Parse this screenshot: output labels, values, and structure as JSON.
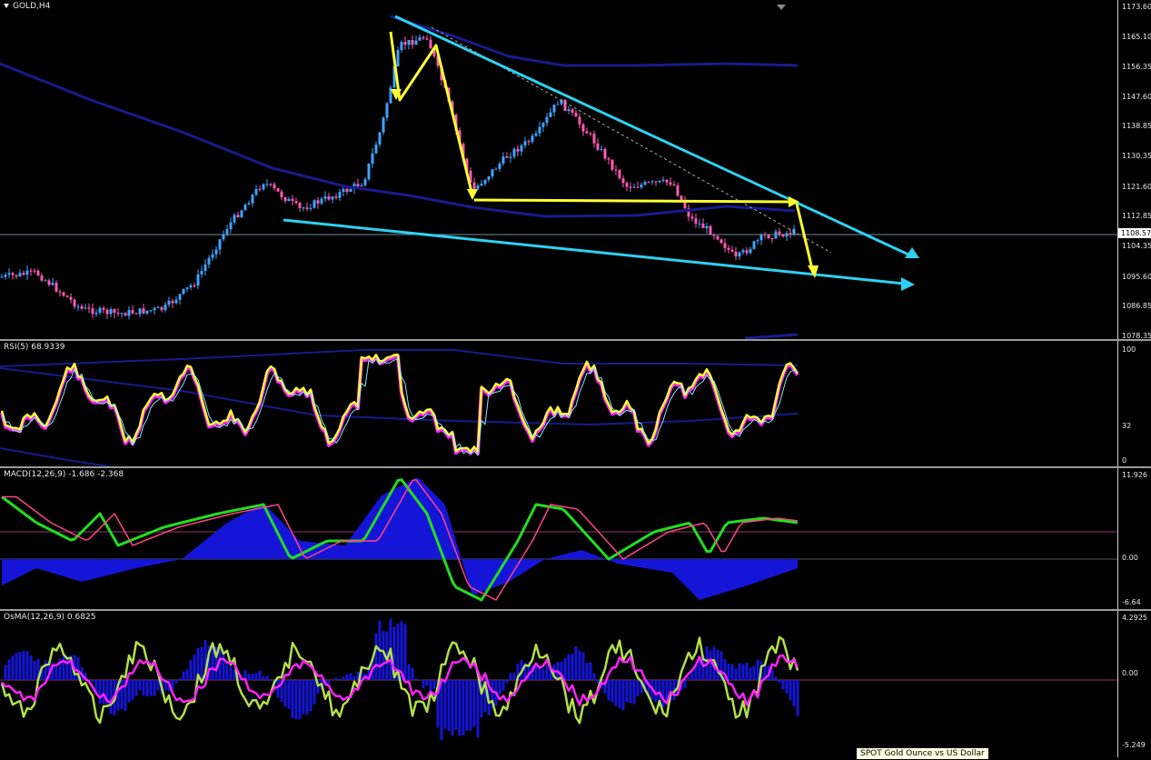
{
  "main": {
    "title": "GOLD,H4",
    "price_ticks": [
      "1173.60",
      "1165.10",
      "1156.35",
      "1147.60",
      "1138.85",
      "1130.35",
      "1121.60",
      "1112.85",
      "1104.35",
      "1095.60",
      "1086.85",
      "1078.35"
    ],
    "current_price": "1108.57"
  },
  "rsi": {
    "title": "RSI(5) 68.9339",
    "ticks": [
      "100",
      "32",
      "0"
    ]
  },
  "macd": {
    "title": "MACD(12,26,9) -1.686 -2.368",
    "ticks": [
      "11.926",
      "0.00",
      "-6.64"
    ]
  },
  "osma": {
    "title": "OsMA(12,26,9) 0.6825",
    "ticks": [
      "4.2925",
      "0.00",
      "-5.249"
    ]
  },
  "tooltip": "SPOT Gold Ounce vs US Dollar",
  "colors": {
    "background": "#000000",
    "trendline": "#2ed1f0",
    "arrows": "#ffff33",
    "bands": "#1a1a8c",
    "rsi_line": "#ffff33",
    "rsi_shadow": "#ff22ff",
    "macd_hist": "#1515d8",
    "macd_line": "#22dd22",
    "signal": "#ff4488",
    "osma_line": "#b2e04a",
    "osma_signal": "#ff22ff"
  }
}
